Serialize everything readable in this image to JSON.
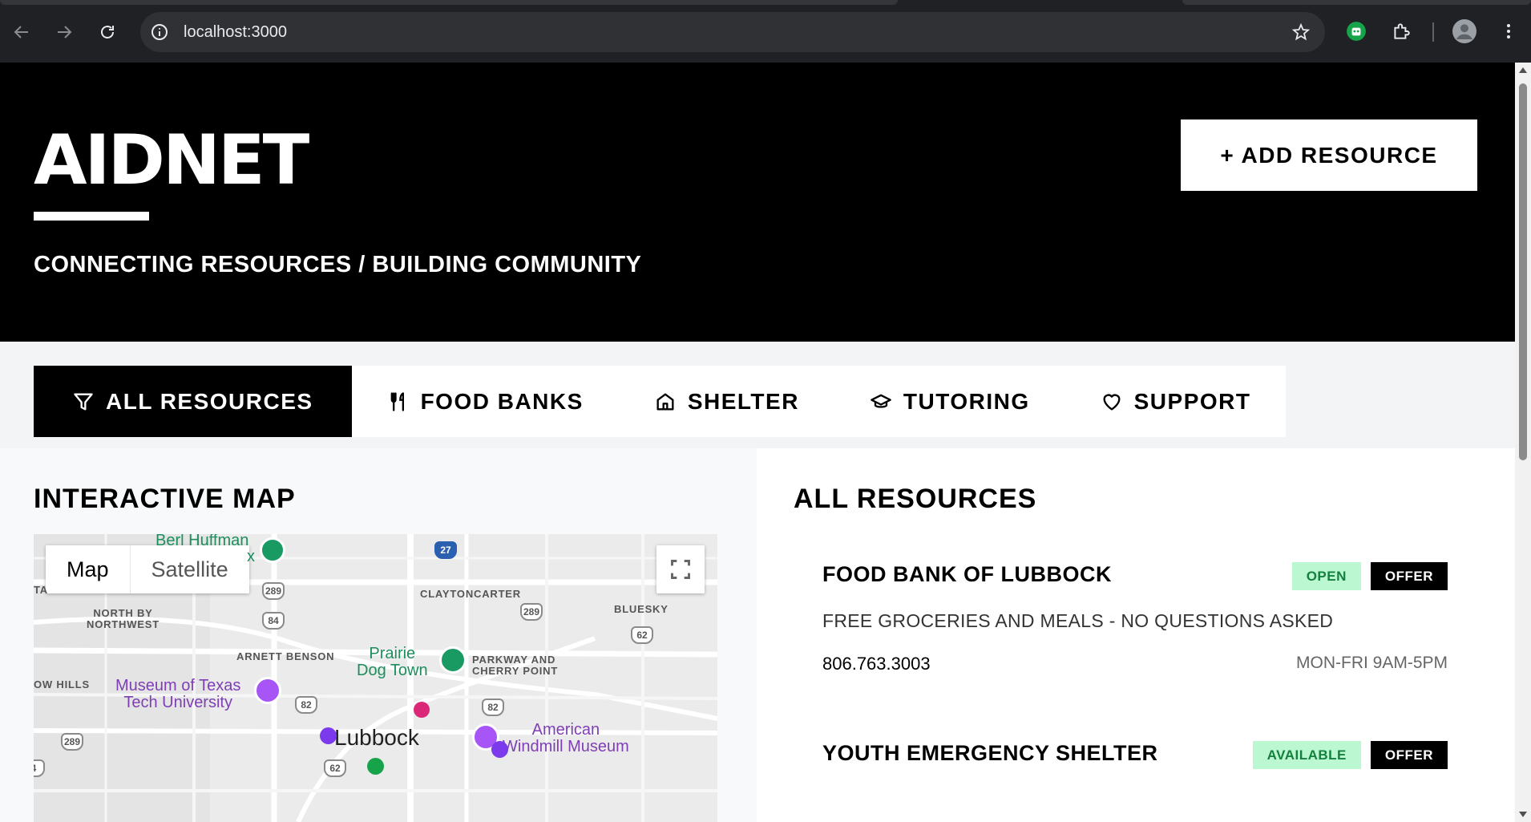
{
  "browser": {
    "url": "localhost:3000"
  },
  "header": {
    "brand": "AIDNET",
    "tagline": "CONNECTING RESOURCES / BUILDING COMMUNITY",
    "add_button": "+ ADD RESOURCE"
  },
  "filters": [
    {
      "label": "ALL RESOURCES",
      "icon": "filter-icon",
      "active": true
    },
    {
      "label": "FOOD BANKS",
      "icon": "utensils-icon",
      "active": false
    },
    {
      "label": "SHELTER",
      "icon": "home-icon",
      "active": false
    },
    {
      "label": "TUTORING",
      "icon": "graduation-cap-icon",
      "active": false
    },
    {
      "label": "SUPPORT",
      "icon": "heart-icon",
      "active": false
    }
  ],
  "map_section": {
    "title": "INTERACTIVE MAP",
    "map_type": {
      "map": "Map",
      "satellite": "Satellite"
    },
    "labels": {
      "berl": "Berl Huffman",
      "berl_suffix": "x",
      "ta": "TA",
      "north_by": "NORTH BY",
      "northwest": "NORTHWEST",
      "claytoncarter": "CLAYTONCARTER",
      "bluesky": "BLUESKY",
      "arnett_benson": "ARNETT BENSON",
      "prairie_1": "Prairie",
      "prairie_2": "Dog Town",
      "parkway_1": "PARKWAY AND",
      "parkway_2": "CHERRY POINT",
      "ow_hills": "OW HILLS",
      "museum_1": "Museum of Texas",
      "museum_2": "Tech University",
      "lubbock": "Lubbock",
      "windmill_1": "American",
      "windmill_2": "Windmill Museum"
    },
    "shields": {
      "i27": "27",
      "s289a": "289",
      "s84": "84",
      "s289b": "289",
      "s62a": "62",
      "s82a": "82",
      "s82b": "82",
      "s289c": "289",
      "s62b": "62",
      "s4": "4"
    },
    "colors": {
      "purple_marker": "#7c3aed",
      "pink_marker": "#db2777",
      "green_marker": "#16a34a"
    }
  },
  "resources_section": {
    "title": "ALL RESOURCES",
    "items": [
      {
        "name": "FOOD BANK OF LUBBOCK",
        "status": "OPEN",
        "type": "OFFER",
        "description": "FREE GROCERIES AND MEALS - NO QUESTIONS ASKED",
        "phone": "806.763.3003",
        "hours": "MON-FRI 9AM-5PM"
      },
      {
        "name": "YOUTH EMERGENCY SHELTER",
        "status": "AVAILABLE",
        "type": "OFFER"
      }
    ]
  }
}
